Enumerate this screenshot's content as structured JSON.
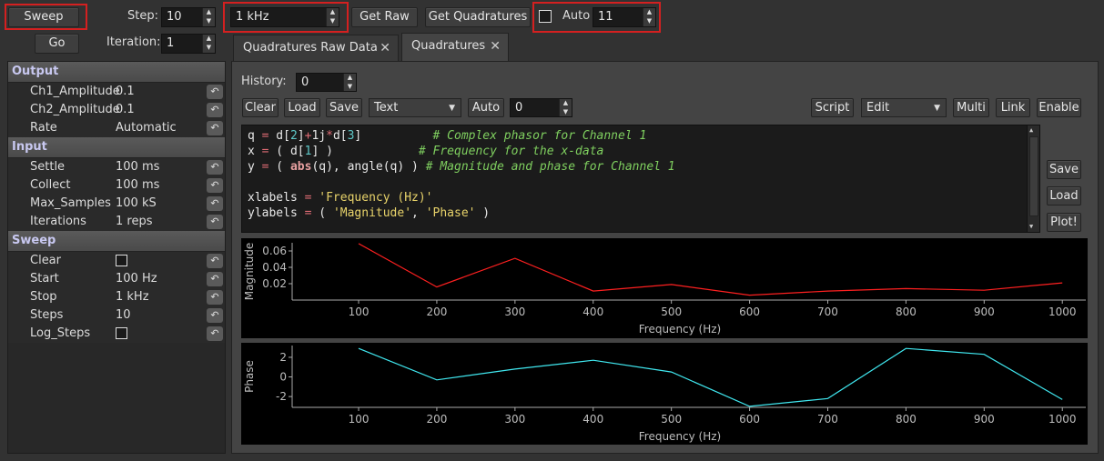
{
  "toolbar": {
    "sweep_label": "Sweep",
    "go_label": "Go",
    "step_label": "Step:",
    "step_value": "10",
    "freq_value": "1 kHz",
    "get_raw_label": "Get Raw",
    "get_quadratures_label": "Get Quadratures",
    "auto_label": "Auto",
    "auto_value": "11",
    "iteration_label": "Iteration:",
    "iteration_value": "1"
  },
  "tree": {
    "output_header": "Output",
    "output_rows": [
      {
        "key": "Ch1_Amplitude",
        "value": "0.1"
      },
      {
        "key": "Ch2_Amplitude",
        "value": "0.1"
      },
      {
        "key": "Rate",
        "value": "Automatic"
      }
    ],
    "input_header": "Input",
    "input_rows": [
      {
        "key": "Settle",
        "value": "100 ms"
      },
      {
        "key": "Collect",
        "value": "100 ms"
      },
      {
        "key": "Max_Samples",
        "value": "100 kS"
      },
      {
        "key": "Iterations",
        "value": "1 reps"
      }
    ],
    "sweep_header": "Sweep",
    "sweep_rows": [
      {
        "key": "Clear",
        "value": ""
      },
      {
        "key": "Start",
        "value": "100 Hz"
      },
      {
        "key": "Stop",
        "value": "1 kHz"
      },
      {
        "key": "Steps",
        "value": "10"
      },
      {
        "key": "Log_Steps",
        "value": ""
      }
    ]
  },
  "tabs": [
    {
      "label": "Quadratures Raw Data"
    },
    {
      "label": "Quadratures"
    }
  ],
  "panel": {
    "history_label": "History:",
    "history_value": "0",
    "clear_label": "Clear",
    "load_label": "Load",
    "save_label": "Save",
    "format_value": "Text",
    "auto_label": "Auto",
    "auto_value": "0",
    "script_label": "Script",
    "edit_value": "Edit",
    "multi_label": "Multi",
    "link_label": "Link",
    "enable_label": "Enable",
    "side_save_label": "Save",
    "side_load_label": "Load",
    "plot_label": "Plot!"
  },
  "chart_data": [
    {
      "type": "line",
      "ylabel": "Magnitude",
      "xlabel": "Frequency (Hz)",
      "color": "#ff2020",
      "x": [
        100,
        200,
        300,
        400,
        500,
        600,
        700,
        800,
        900,
        1000
      ],
      "y": [
        0.069,
        0.016,
        0.051,
        0.011,
        0.019,
        0.006,
        0.011,
        0.014,
        0.012,
        0.021
      ],
      "xlim": [
        15,
        1030
      ],
      "ylim": [
        0.0,
        0.07
      ],
      "yticks": [
        0.02,
        0.04,
        0.06
      ],
      "yticklabels": [
        "0.02",
        "0.04",
        "0.06"
      ],
      "xticks": [
        100,
        200,
        300,
        400,
        500,
        600,
        700,
        800,
        900,
        1000
      ]
    },
    {
      "type": "line",
      "ylabel": "Phase",
      "xlabel": "Frequency (Hz)",
      "color": "#40e8f0",
      "x": [
        100,
        200,
        300,
        400,
        500,
        600,
        700,
        800,
        900,
        1000
      ],
      "y": [
        2.9,
        -0.3,
        0.8,
        1.7,
        0.5,
        -3.0,
        -2.2,
        2.9,
        2.3,
        -2.3
      ],
      "xlim": [
        15,
        1030
      ],
      "ylim": [
        -3.1,
        3.2
      ],
      "yticks": [
        -2,
        0,
        2
      ],
      "yticklabels": [
        "-2",
        "0",
        "2"
      ],
      "xticks": [
        100,
        200,
        300,
        400,
        500,
        600,
        700,
        800,
        900,
        1000
      ]
    }
  ]
}
